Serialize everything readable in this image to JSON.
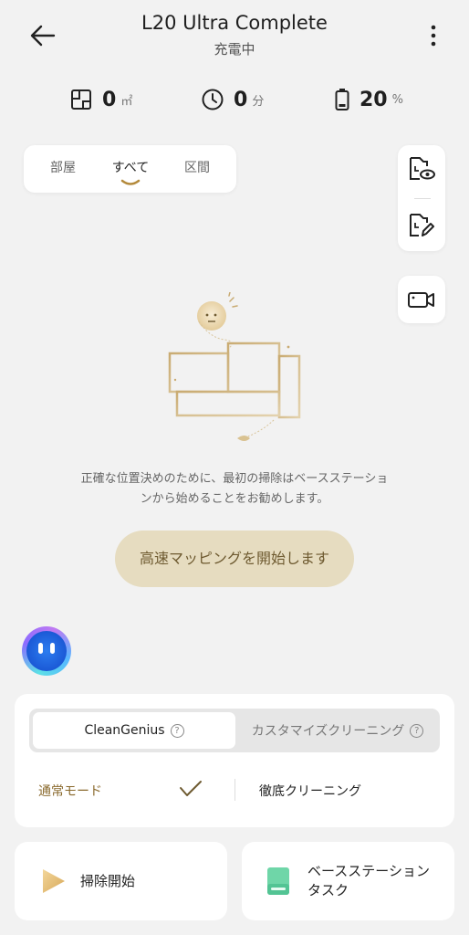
{
  "header": {
    "title": "L20 Ultra Complete",
    "status": "充電中"
  },
  "stats": {
    "area": {
      "value": "0",
      "unit": "㎡",
      "icon": "floorplan-icon"
    },
    "time": {
      "value": "0",
      "unit": "分",
      "icon": "clock-icon"
    },
    "battery": {
      "value": "20",
      "unit": "%",
      "icon": "battery-icon"
    }
  },
  "map_tabs": {
    "items": [
      "部屋",
      "すべて",
      "区間"
    ],
    "active": "すべて"
  },
  "map_message": "正確な位置決めのために、最初の掃除はベースステーションから始めることをお勧めします。",
  "map_message_lines": [
    "正確な位置決めのために、最初の掃除はベースステーショ",
    "ンから始めることをお勧めします。"
  ],
  "start_mapping_button": "高速マッピングを開始します",
  "cleaning_mode": {
    "options": [
      "CleanGenius",
      "カスタマイズクリーニング"
    ],
    "selected": "CleanGenius",
    "normal_mode": "通常モード",
    "deep_clean": "徹底クリーニング"
  },
  "bottom_actions": {
    "start_clean": "掃除開始",
    "base_station_line1": "ベースステーション",
    "base_station_line2": "タスク"
  },
  "colors": {
    "accent": "#b48a3c",
    "accent_light": "#e6dcc0",
    "accent_text": "#6e5a30",
    "background": "#f2f2f2",
    "station_green": "#6fd6a8"
  }
}
